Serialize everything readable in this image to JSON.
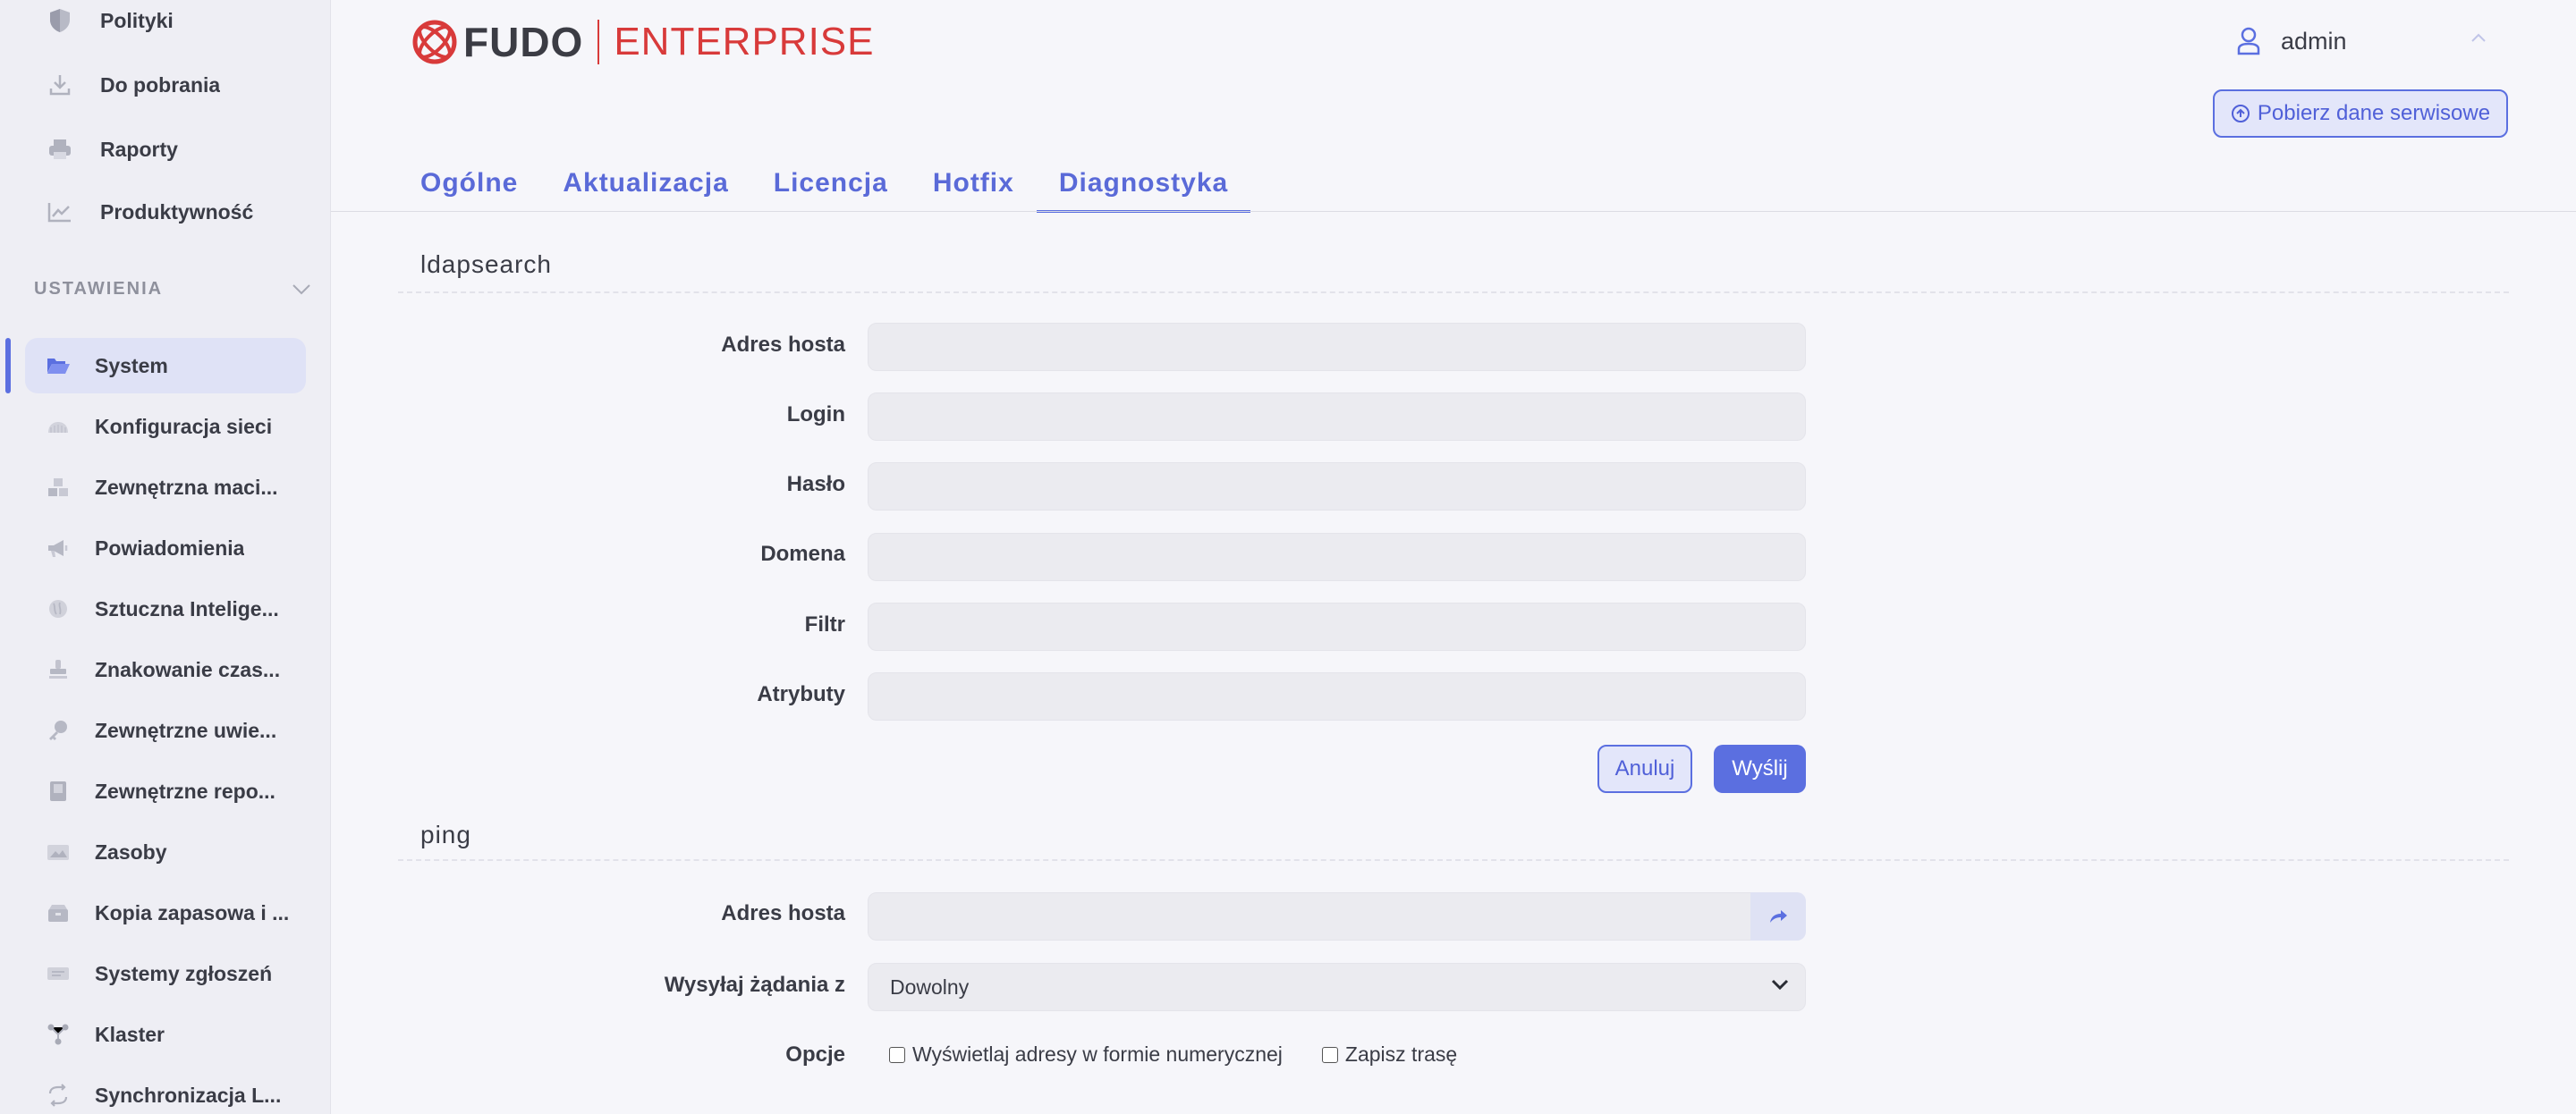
{
  "sidebar": {
    "top_items": [
      {
        "label": "Polityki",
        "icon": "shield-icon"
      },
      {
        "label": "Do pobrania",
        "icon": "download-icon"
      },
      {
        "label": "Raporty",
        "icon": "printer-icon"
      },
      {
        "label": "Produktywność",
        "icon": "trend-chart-icon"
      }
    ],
    "section_title": "USTAWIENIA",
    "settings_items": [
      {
        "label": "System",
        "icon": "folder-open-icon"
      },
      {
        "label": "Konfiguracja sieci",
        "icon": "network-icon"
      },
      {
        "label": "Zewnętrzna maci...",
        "icon": "cubes-icon"
      },
      {
        "label": "Powiadomienia",
        "icon": "megaphone-icon"
      },
      {
        "label": "Sztuczna Intelige...",
        "icon": "brain-icon"
      },
      {
        "label": "Znakowanie czas...",
        "icon": "stamp-icon"
      },
      {
        "label": "Zewnętrzne uwie...",
        "icon": "key-icon"
      },
      {
        "label": "Zewnętrzne repo...",
        "icon": "book-icon"
      },
      {
        "label": "Zasoby",
        "icon": "image-icon"
      },
      {
        "label": "Kopia zapasowa i ...",
        "icon": "archive-icon"
      },
      {
        "label": "Systemy zgłoszeń",
        "icon": "ticket-icon"
      },
      {
        "label": "Klaster",
        "icon": "cluster-icon"
      },
      {
        "label": "Synchronizacja L...",
        "icon": "sync-icon"
      }
    ]
  },
  "header": {
    "logo_brand": "FUDO",
    "logo_edition": "ENTERPRISE",
    "user_name": "admin",
    "service_button": "Pobierz dane serwisowe"
  },
  "tabs": [
    {
      "label": "Ogólne"
    },
    {
      "label": "Aktualizacja"
    },
    {
      "label": "Licencja"
    },
    {
      "label": "Hotfix"
    },
    {
      "label": "Diagnostyka"
    }
  ],
  "ldapsearch": {
    "title": "ldapsearch",
    "fields": [
      {
        "label": "Adres hosta",
        "value": ""
      },
      {
        "label": "Login",
        "value": ""
      },
      {
        "label": "Hasło",
        "value": ""
      },
      {
        "label": "Domena",
        "value": ""
      },
      {
        "label": "Filtr",
        "value": ""
      },
      {
        "label": "Atrybuty",
        "value": ""
      }
    ],
    "cancel_label": "Anuluj",
    "submit_label": "Wyślij"
  },
  "ping": {
    "title": "ping",
    "host_label": "Adres hosta",
    "host_value": "",
    "source_label": "Wysyłaj żądania z",
    "source_value": "Dowolny",
    "options_label": "Opcje",
    "option_numeric": "Wyświetlaj adresy w formie numerycznej",
    "option_route": "Zapisz trasę"
  },
  "colors": {
    "accent": "#5b6fe0",
    "brand_red": "#d83a3a",
    "background": "#f6f6fa",
    "sidebar": "#eeeef4"
  }
}
